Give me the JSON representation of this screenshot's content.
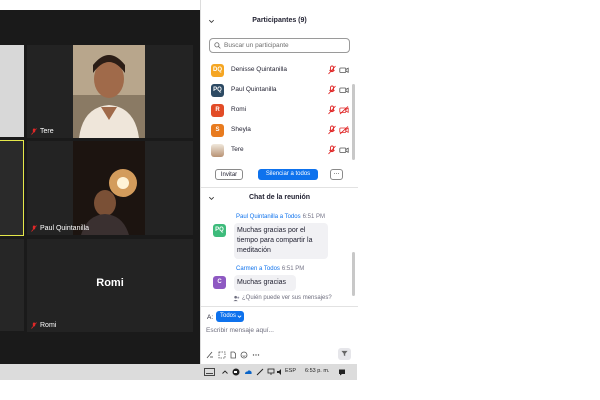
{
  "video": {
    "tiles": [
      {
        "name": "Tere"
      },
      {
        "name": "Paul Quintanilla"
      },
      {
        "name": "Romi",
        "display_name": "Romi"
      }
    ]
  },
  "participants": {
    "title": "Participantes (9)",
    "search_placeholder": "Buscar un participante",
    "items": [
      {
        "initials": "DQ",
        "name": "Denisse Quintanilla",
        "color": "#f5a623"
      },
      {
        "initials": "PQ",
        "name": "Paul Quintanilla",
        "color": "#2d4a63"
      },
      {
        "initials": "R",
        "name": "Romi",
        "color": "#e24c27"
      },
      {
        "initials": "S",
        "name": "Sheyla",
        "color": "#e87b1f"
      },
      {
        "initials": "",
        "name": "Tere",
        "color": "#c9a98a"
      }
    ],
    "invite_label": "Invitar",
    "mute_all_label": "Silenciar a todos",
    "more_label": "..."
  },
  "chat": {
    "title": "Chat de la reunión",
    "messages": [
      {
        "sender": "Paul Quintanilla a Todos",
        "time": "6:51 PM",
        "initials": "PQ",
        "color": "#3dbb7b",
        "lines": [
          "Muchas gracias por el",
          "tiempo para compartir la",
          "meditación"
        ]
      },
      {
        "sender": "Carmen a Todos",
        "time": "6:51 PM",
        "initials": "C",
        "color": "#8e59c2",
        "lines": [
          "Muchas gracias"
        ]
      }
    ],
    "privacy_note": "¿Quién puede ver sus mensajes?",
    "to_label": "A:",
    "to_value": "Todos",
    "compose_placeholder": "Escribir mensaje aquí..."
  },
  "taskbar": {
    "lang": "ESP",
    "clock": "6:53 p. m."
  },
  "colors": {
    "accent": "#0e72ed",
    "mute_red": "#e02828",
    "active_speaker": "#e5e84a"
  }
}
